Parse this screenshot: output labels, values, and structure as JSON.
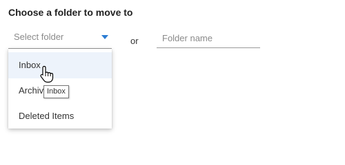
{
  "dialog": {
    "heading": "Choose a folder to move to"
  },
  "select": {
    "placeholder": "Select folder"
  },
  "separator": {
    "or_label": "or"
  },
  "folder_name": {
    "placeholder": "Folder name",
    "value": ""
  },
  "dropdown": {
    "items": [
      {
        "label": "Inbox",
        "hovered": true
      },
      {
        "label": "Archive",
        "hovered": false
      },
      {
        "label": "Deleted Items",
        "hovered": false
      }
    ]
  },
  "tooltip": {
    "text": "Inbox"
  },
  "colors": {
    "accent": "#2b7cd3",
    "hover_background": "#edf3fb"
  },
  "cursor": {
    "icon": "hand-pointer-icon"
  }
}
